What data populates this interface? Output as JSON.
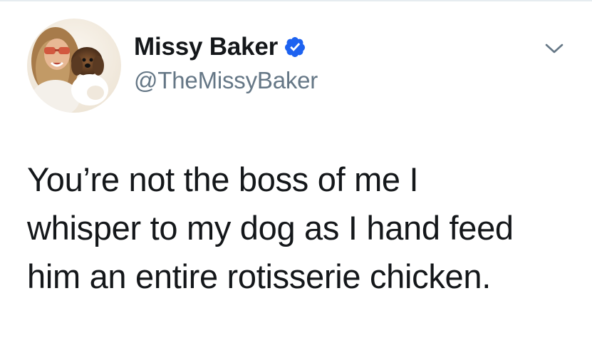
{
  "tweet": {
    "author": {
      "display_name": "Missy Baker",
      "handle": "@TheMissyBaker",
      "verified": true,
      "avatar_icon": "profile-photo-woman-with-dog"
    },
    "text_lines": [
      "You’re not the boss of me I",
      "whisper to my dog as I hand feed",
      "him an entire rotisserie chicken."
    ],
    "menu_icon": "chevron-down-icon"
  },
  "colors": {
    "text_primary": "#14171a",
    "text_secondary": "#657786",
    "verified_blue": "#1da1f2",
    "divider": "#e6ecf0"
  }
}
